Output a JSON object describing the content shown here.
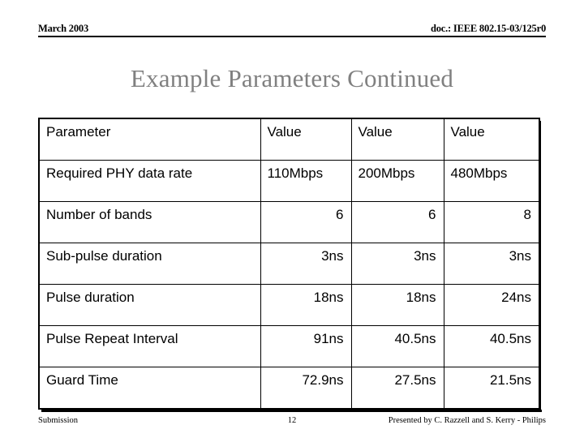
{
  "header": {
    "date": "March 2003",
    "doc_id": "doc.: IEEE 802.15-03/125r0"
  },
  "title": "Example Parameters Continued",
  "table": {
    "columns": [
      "Parameter",
      "Value",
      "Value",
      "Value"
    ],
    "rows": [
      {
        "parameter": "Required PHY data rate",
        "values": [
          "110Mbps",
          "200Mbps",
          "480Mbps"
        ],
        "align": "fill"
      },
      {
        "parameter": "Number of bands",
        "values": [
          "6",
          "6",
          "8"
        ],
        "align": "right"
      },
      {
        "parameter": "Sub-pulse duration",
        "values": [
          "3ns",
          "3ns",
          "3ns"
        ],
        "align": "right"
      },
      {
        "parameter": "Pulse duration",
        "values": [
          "18ns",
          "18ns",
          "24ns"
        ],
        "align": "right"
      },
      {
        "parameter": "Pulse Repeat Interval",
        "values": [
          "91ns",
          "40.5ns",
          "40.5ns"
        ],
        "align": "right"
      },
      {
        "parameter": "Guard Time",
        "values": [
          "72.9ns",
          "27.5ns",
          "21.5ns"
        ],
        "align": "right"
      }
    ]
  },
  "footer": {
    "left": "Submission",
    "page": "12",
    "right": "Presented by C. Razzell and S. Kerry - Philips"
  },
  "colors": {
    "title": "#808080",
    "text": "#000000",
    "background": "#ffffff"
  }
}
